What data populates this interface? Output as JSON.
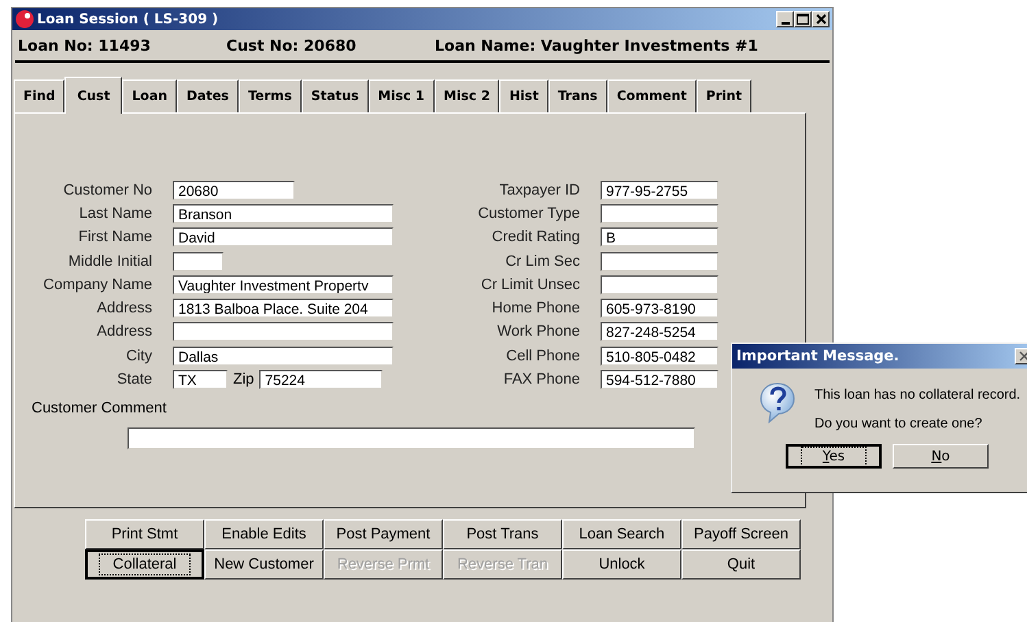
{
  "window": {
    "title": "Loan Session  ( LS-309 )"
  },
  "header": [
    {
      "label": "Loan No:  11493"
    },
    {
      "label": "Cust No: 20680"
    },
    {
      "label": "Loan Name: Vaughter Investments #1"
    }
  ],
  "tabs": [
    {
      "label": "Find",
      "selected": false
    },
    {
      "label": "Cust",
      "selected": true
    },
    {
      "label": "Loan",
      "selected": false
    },
    {
      "label": "Dates",
      "selected": false
    },
    {
      "label": "Terms",
      "selected": false
    },
    {
      "label": "Status",
      "selected": false
    },
    {
      "label": "Misc 1",
      "selected": false
    },
    {
      "label": "Misc 2",
      "selected": false
    },
    {
      "label": "Hist",
      "selected": false
    },
    {
      "label": "Trans",
      "selected": false
    },
    {
      "label": "Comment",
      "selected": false
    },
    {
      "label": "Print",
      "selected": false
    }
  ],
  "left_fields": [
    {
      "kind": "short",
      "label": "Customer No",
      "value": "20680"
    },
    {
      "kind": "long",
      "label": "Last Name",
      "value": "Branson"
    },
    {
      "kind": "long",
      "label": "First Name",
      "value": "David"
    },
    {
      "kind": "tiny",
      "label": "Middle Initial"
    },
    {
      "kind": "long",
      "label": "Company Name",
      "value": "Vaughter Investment Propertv"
    },
    {
      "kind": "long",
      "label": "Address",
      "value": "1813 Balboa Place. Suite 204"
    },
    {
      "kind": "long",
      "label": "Address"
    },
    {
      "kind": "long",
      "label": "City",
      "value": "Dallas"
    },
    {
      "kind": "pair",
      "label": "State",
      "value": "TX",
      "label2": "Zip",
      "value2": "75224"
    }
  ],
  "right_fields": [
    {
      "label": "Taxpayer ID",
      "value": "977-95-2755"
    },
    {
      "label": "Customer Type"
    },
    {
      "label": "Credit Rating",
      "value": "B"
    },
    {
      "label": "Cr Lim Sec"
    },
    {
      "label": "Cr Limit Unsec"
    },
    {
      "label": "Home Phone",
      "value": "605-973-8190"
    },
    {
      "label": "Work Phone",
      "value": "827-248-5254"
    },
    {
      "label": "Cell Phone",
      "value": "510-805-0482"
    },
    {
      "label": "FAX Phone",
      "value": "594-512-7880"
    }
  ],
  "comment": {
    "label": "Customer Comment"
  },
  "buttons": [
    {
      "label": "Print Stmt",
      "disabled": false,
      "focused": false
    },
    {
      "label": "Enable Edits",
      "disabled": false,
      "focused": false
    },
    {
      "label": "Post Payment",
      "disabled": false,
      "focused": false
    },
    {
      "label": "Post Trans",
      "disabled": false,
      "focused": false
    },
    {
      "label": "Loan Search",
      "disabled": false,
      "focused": false
    },
    {
      "label": "Payoff Screen",
      "disabled": false,
      "focused": false
    },
    {
      "label": "Collateral",
      "disabled": false,
      "focused": true
    },
    {
      "label": "New Customer",
      "disabled": false,
      "focused": false
    },
    {
      "label": "Reverse Prmt",
      "disabled": true,
      "focused": false
    },
    {
      "label": "Reverse Tran",
      "disabled": true,
      "focused": false
    },
    {
      "label": "Unlock",
      "disabled": false,
      "focused": false
    },
    {
      "label": "Quit",
      "disabled": false,
      "focused": false
    }
  ],
  "dialog": {
    "title": "Important Message.",
    "lines": [
      "This loan has no collateral record.",
      "Do you want to create one?"
    ],
    "buttons": [
      {
        "label": "Yes",
        "focused": true
      },
      {
        "label": "No",
        "focused": false
      }
    ]
  }
}
